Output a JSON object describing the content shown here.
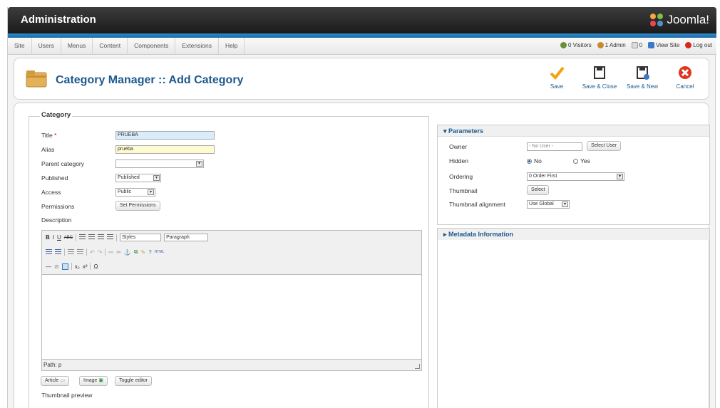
{
  "header": {
    "title": "Administration",
    "logo_text": "Joomla!"
  },
  "menu": [
    "Site",
    "Users",
    "Menus",
    "Content",
    "Components",
    "Extensions",
    "Help"
  ],
  "status": {
    "visitors": "0 Visitors",
    "admin": "1 Admin",
    "messages": "0",
    "view_site": "View Site",
    "logout": "Log out"
  },
  "toolbar": {
    "page_title": "Category Manager :: Add Category",
    "save": "Save",
    "save_close": "Save & Close",
    "save_new": "Save & New",
    "cancel": "Cancel"
  },
  "form": {
    "legend": "Category",
    "title_label": "Title",
    "required_mark": "*",
    "title_value": "PRUEBA",
    "alias_label": "Alias",
    "alias_value": "prueba",
    "parent_label": "Parent category",
    "parent_value": "",
    "published_label": "Published",
    "published_value": "Published",
    "access_label": "Access",
    "access_value": "Public",
    "permissions_label": "Permissions",
    "permissions_button": "Set Permissions",
    "description_label": "Description",
    "editor_styles": "Styles",
    "editor_paragraph": "Paragraph",
    "editor_path": "Path: p",
    "article_button": "Article",
    "image_button": "Image",
    "toggle_button": "Toggle editor",
    "thumbnail_preview": "Thumbnail preview"
  },
  "parameters": {
    "heading": "Parameters",
    "owner_label": "Owner",
    "owner_value": "- No User -",
    "select_user": "Select User",
    "hidden_label": "Hidden",
    "hidden_no": "No",
    "hidden_yes": "Yes",
    "hidden_selected": "No",
    "ordering_label": "Ordering",
    "ordering_value": "0 Order First",
    "thumbnail_label": "Thumbnail",
    "thumbnail_button": "Select",
    "thumb_align_label": "Thumbnail alignment",
    "thumb_align_value": "Use Global"
  },
  "metadata": {
    "heading": "Metadata Information"
  },
  "colors": {
    "accent": "#1d5a8e",
    "header": "#2a2a2a",
    "bluebar": "#2f8ccc"
  }
}
